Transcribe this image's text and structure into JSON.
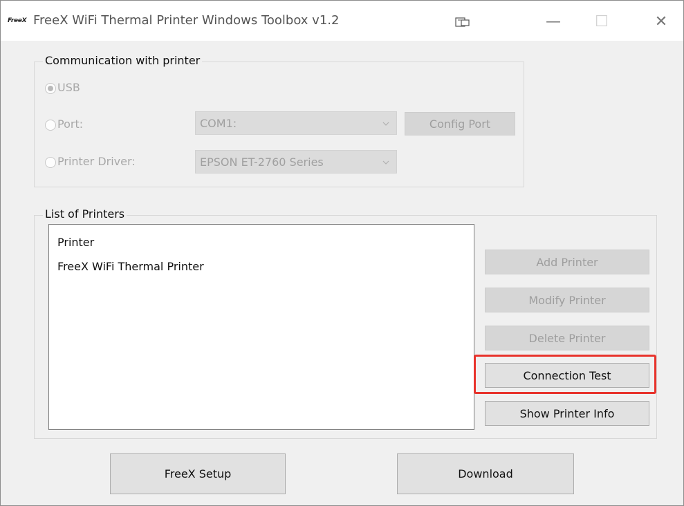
{
  "window": {
    "logo": "FreeX",
    "title": "FreeX WiFi Thermal Printer Windows Toolbox v1.2",
    "minimize_glyph": "—",
    "maximize_glyph": "☐",
    "close_glyph": "✕"
  },
  "communication": {
    "legend": "Communication with printer",
    "usb_label": "USB",
    "usb_selected": true,
    "port_label": "Port:",
    "port_value": "COM1:",
    "config_port_label": "Config Port",
    "driver_label": "Printer Driver:",
    "driver_value": "EPSON ET-2760 Series"
  },
  "printers": {
    "legend": "List of Printers",
    "items": [
      "Printer",
      "FreeX WiFi Thermal Printer"
    ],
    "add_label": "Add Printer",
    "modify_label": "Modify Printer",
    "delete_label": "Delete Printer",
    "connection_test_label": "Connection Test",
    "show_info_label": "Show Printer Info"
  },
  "footer": {
    "setup_label": "FreeX Setup",
    "download_label": "Download"
  },
  "colors": {
    "highlight": "#e8332c",
    "window_bg": "#f0f0f0"
  }
}
